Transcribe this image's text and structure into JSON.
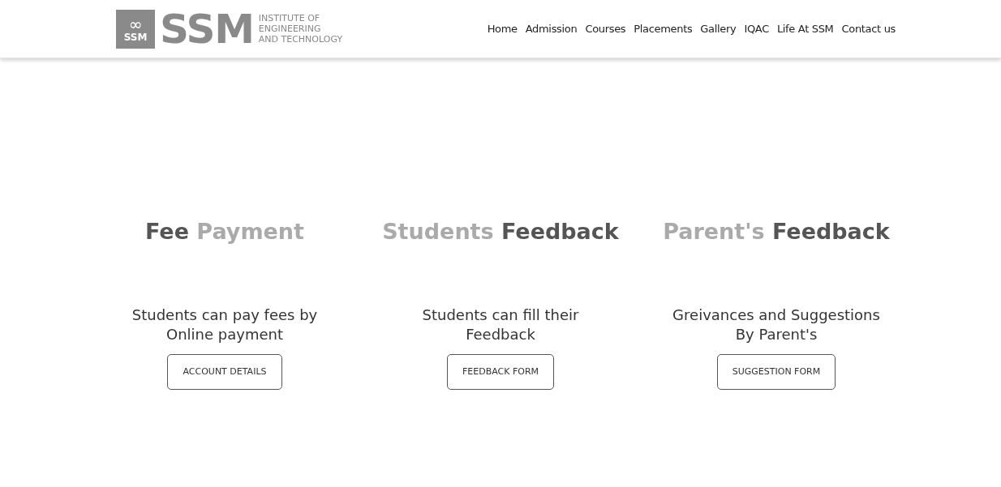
{
  "logo": {
    "badge_symbol": "∞",
    "badge_text": "SSM",
    "wordmark": "SSM",
    "tagline": [
      "INSTITUTE OF",
      "ENGINEERING",
      "AND TECHNOLOGY"
    ]
  },
  "nav": [
    "Home",
    "Admission",
    "Courses",
    "Placements",
    "Gallery",
    "IQAC",
    "Life At SSM",
    "Contact us"
  ],
  "cards": [
    {
      "title": [
        {
          "text": "Fee",
          "color": "#555555"
        },
        {
          "text": "Payment",
          "color": "#aaaaaa"
        }
      ],
      "description": [
        "Students can pay fees by",
        "Online payment"
      ],
      "button": "ACCOUNT DETAILS"
    },
    {
      "title": [
        {
          "text": "Students",
          "color": "#aaaaaa"
        },
        {
          "text": "Feedback",
          "color": "#555555"
        }
      ],
      "description": [
        "Students can fill their",
        "Feedback"
      ],
      "button": "FEEDBACK FORM"
    },
    {
      "title": [
        {
          "text": "Parent's",
          "color": "#aaaaaa"
        },
        {
          "text": "Feedback",
          "color": "#555555"
        }
      ],
      "description": [
        "Greivances and Suggestions",
        "By Parent's"
      ],
      "button": "SUGGESTION FORM"
    }
  ]
}
